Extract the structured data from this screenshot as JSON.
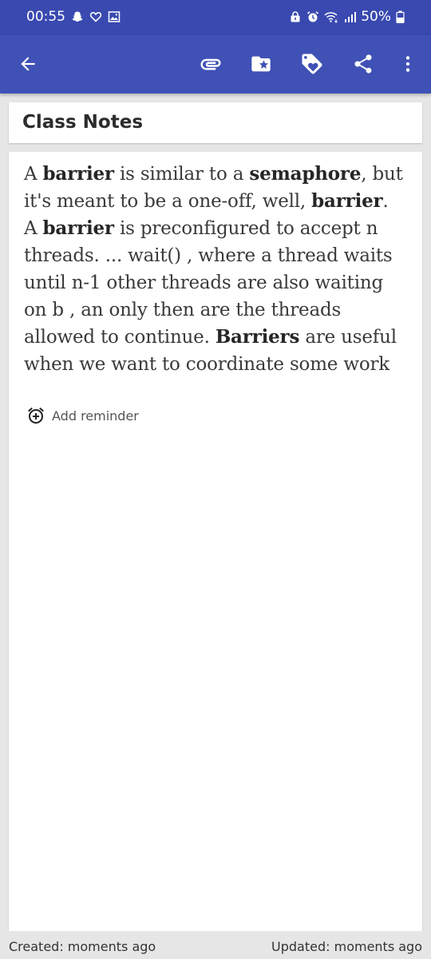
{
  "status_bar": {
    "time": "00:55",
    "battery": "50%",
    "left_icons": [
      "snapchat-icon",
      "heart-outline-icon",
      "image-icon"
    ],
    "right_icons": [
      "lock-icon",
      "alarm-icon",
      "wifi-icon",
      "signal-icon",
      "battery-icon"
    ]
  },
  "toolbar": {
    "color": "#3f51b5",
    "status_color": "#3949b0",
    "icons": [
      "back-arrow-icon",
      "paperclip-icon",
      "folder-star-icon",
      "tag-heart-icon",
      "share-icon",
      "more-vert-icon"
    ]
  },
  "note": {
    "title": "Class Notes",
    "body_lines": [
      [
        {
          "t": "A ",
          "b": false
        },
        {
          "t": "barrier",
          "b": true
        },
        {
          "t": " is similar to a ",
          "b": false
        },
        {
          "t": "semaphore",
          "b": true
        },
        {
          "t": ", but",
          "b": false
        }
      ],
      [
        {
          "t": "it's meant to be a one-off, well, ",
          "b": false
        },
        {
          "t": "barrier",
          "b": true
        },
        {
          "t": ".",
          "b": false
        }
      ],
      [
        {
          "t": "A ",
          "b": false
        },
        {
          "t": "barrier",
          "b": true
        },
        {
          "t": " is preconfigured to accept n",
          "b": false
        }
      ],
      [
        {
          "t": "threads. ... wait() , where a thread waits",
          "b": false
        }
      ],
      [
        {
          "t": "until n-1 other threads are also waiting",
          "b": false
        }
      ],
      [
        {
          "t": "on b , an only then are the threads",
          "b": false
        }
      ],
      [
        {
          "t": "allowed to continue. ",
          "b": false
        },
        {
          "t": "Barriers",
          "b": true
        },
        {
          "t": " are useful",
          "b": false
        }
      ],
      [
        {
          "t": "when we want to coordinate some work",
          "b": false
        }
      ]
    ],
    "reminder_label": "Add reminder"
  },
  "footer": {
    "created": "Created: moments ago",
    "updated": "Updated: moments ago"
  }
}
